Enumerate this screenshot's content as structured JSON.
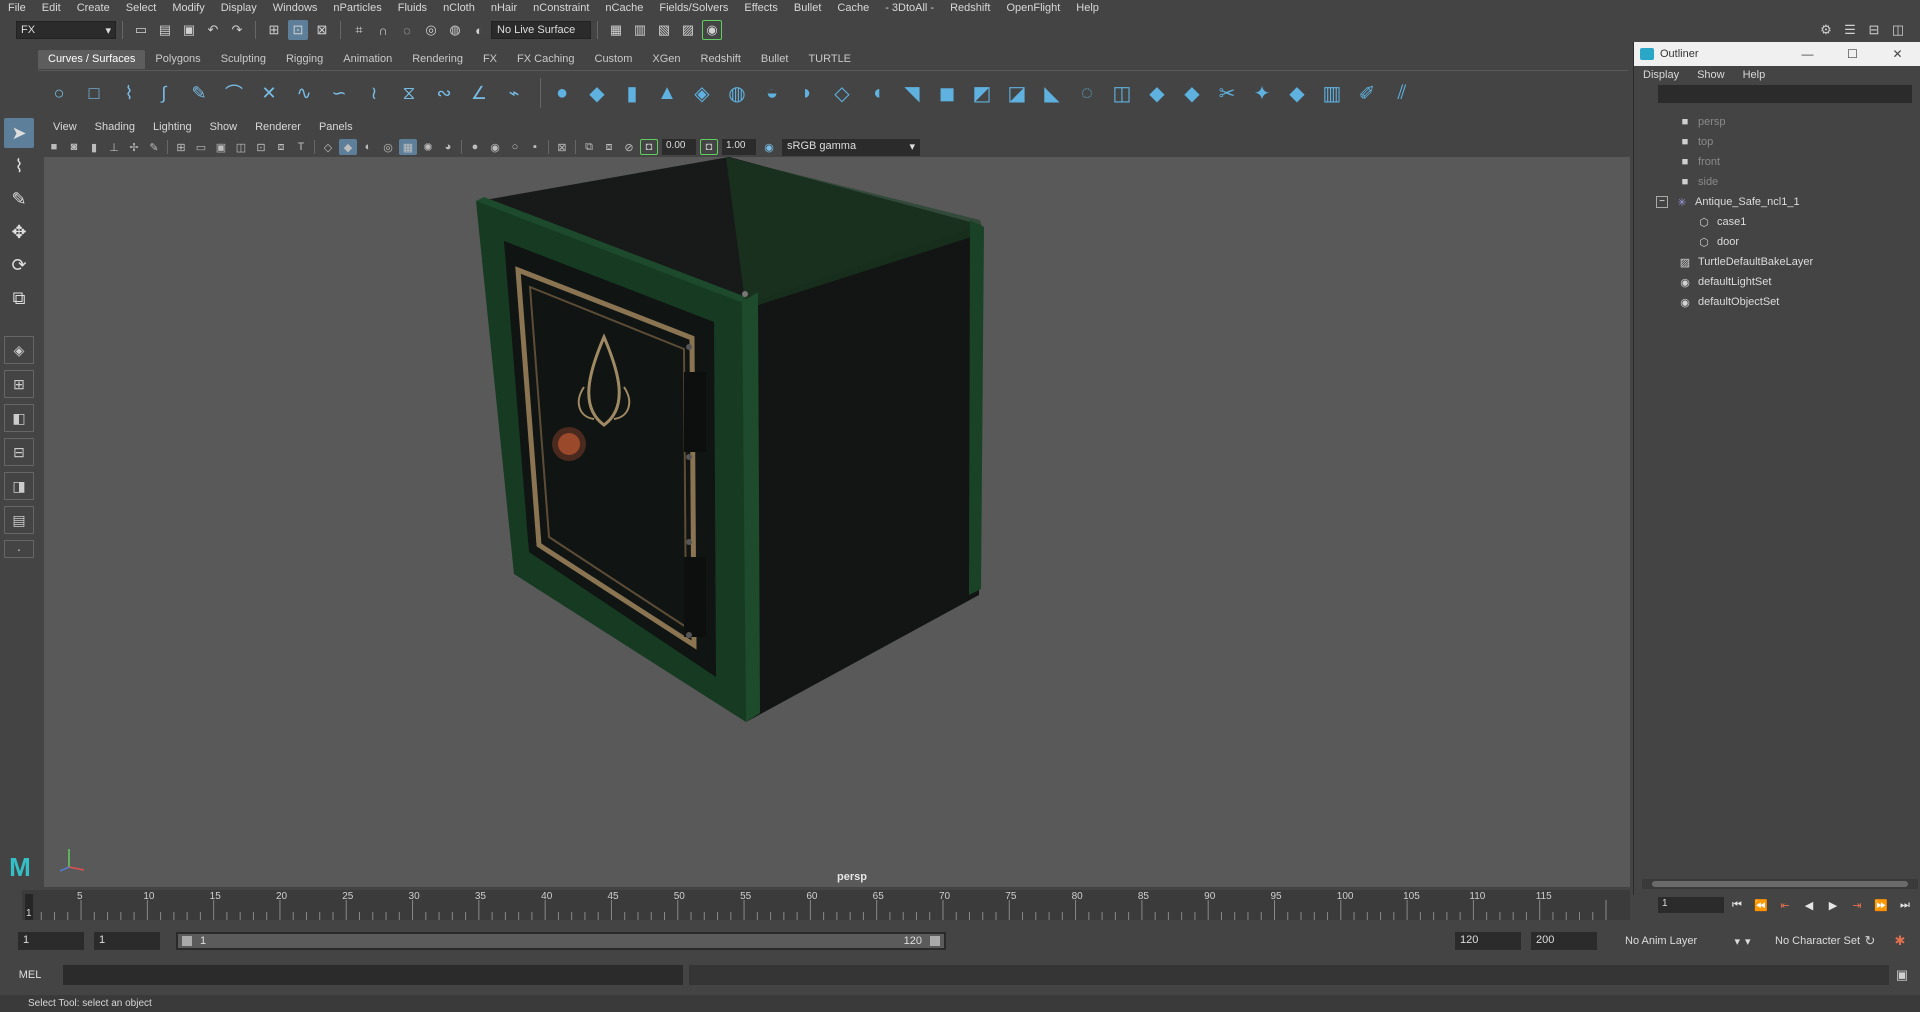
{
  "menubar": [
    "File",
    "Edit",
    "Create",
    "Select",
    "Modify",
    "Display",
    "Windows",
    "nParticles",
    "Fluids",
    "nCloth",
    "nHair",
    "nConstraint",
    "nCache",
    "Fields/Solvers",
    "Effects",
    "Bullet",
    "Cache",
    "- 3DtoAll -",
    "Redshift",
    "OpenFlight",
    "Help"
  ],
  "statusline": {
    "mode": "FX",
    "live_surface": "No Live Surface"
  },
  "shelf": {
    "tabs": [
      "Curves / Surfaces",
      "Polygons",
      "Sculpting",
      "Rigging",
      "Animation",
      "Rendering",
      "FX",
      "FX Caching",
      "Custom",
      "XGen",
      "Redshift",
      "Bullet",
      "TURTLE"
    ],
    "active_tab": "Curves / Surfaces"
  },
  "panel": {
    "menu": [
      "View",
      "Shading",
      "Lighting",
      "Show",
      "Renderer",
      "Panels"
    ],
    "exposure": "0.00",
    "gamma": "1.00",
    "color_space": "sRGB gamma",
    "camera": "persp"
  },
  "timeline": {
    "ticks": [
      5,
      10,
      15,
      20,
      25,
      30,
      35,
      40,
      45,
      50,
      55,
      60,
      65,
      70,
      75,
      80,
      85,
      90,
      95,
      100,
      105,
      110,
      115
    ],
    "first_tick": "1",
    "current_frame": "1"
  },
  "range": {
    "start": "1",
    "playback_start": "1",
    "slider_start": "1",
    "slider_end": "120",
    "playback_end": "120",
    "end": "200",
    "anim_layer": "No Anim Layer",
    "character_set": "No Character Set"
  },
  "cmdline": {
    "label": "MEL"
  },
  "helpline": "Select Tool: select an object",
  "outliner": {
    "title": "Outliner",
    "menu": [
      "Display",
      "Show",
      "Help"
    ],
    "items": [
      {
        "label": "persp",
        "icon": "camera-icon",
        "depth": 0,
        "dim": true
      },
      {
        "label": "top",
        "icon": "camera-icon",
        "depth": 0,
        "dim": true
      },
      {
        "label": "front",
        "icon": "camera-icon",
        "depth": 0,
        "dim": true
      },
      {
        "label": "side",
        "icon": "camera-icon",
        "depth": 0,
        "dim": true
      },
      {
        "label": "Antique_Safe_ncl1_1",
        "icon": "group-icon",
        "depth": 0,
        "dim": false,
        "expanded": true
      },
      {
        "label": "case1",
        "icon": "mesh-icon",
        "depth": 1,
        "dim": false
      },
      {
        "label": "door",
        "icon": "mesh-icon",
        "depth": 1,
        "dim": false
      },
      {
        "label": "TurtleDefaultBakeLayer",
        "icon": "bake-layer-icon",
        "depth": 0,
        "dim": false
      },
      {
        "label": "defaultLightSet",
        "icon": "set-icon",
        "depth": 0,
        "dim": false
      },
      {
        "label": "defaultObjectSet",
        "icon": "set-icon",
        "depth": 0,
        "dim": false
      }
    ]
  },
  "colors": {
    "accent": "#5d7f9a",
    "shelf_icon": "#79bde6",
    "viewport_bg": "#595959",
    "safe_green": "#1f4a2a"
  }
}
